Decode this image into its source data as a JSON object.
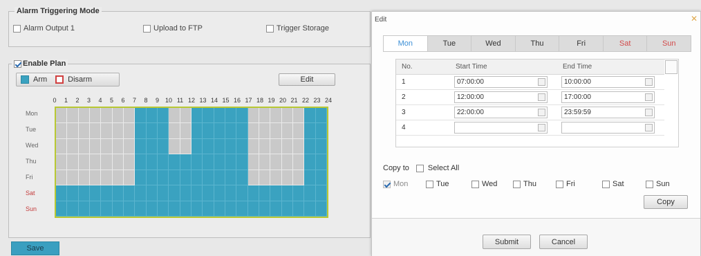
{
  "alarm_mode": {
    "title": "Alarm Triggering Mode",
    "options": [
      {
        "label": "Alarm Output 1",
        "checked": false
      },
      {
        "label": "Upload to FTP",
        "checked": false
      },
      {
        "label": "Trigger Storage",
        "checked": false
      }
    ]
  },
  "plan": {
    "title": "Enable Plan",
    "enabled": true,
    "legend_arm": "Arm",
    "legend_disarm": "Disarm",
    "edit_label": "Edit",
    "hours": [
      "0",
      "1",
      "2",
      "3",
      "4",
      "5",
      "6",
      "7",
      "8",
      "9",
      "10",
      "11",
      "12",
      "13",
      "14",
      "15",
      "16",
      "17",
      "18",
      "19",
      "20",
      "21",
      "22",
      "23",
      "24"
    ],
    "days": [
      "Mon",
      "Tue",
      "Wed",
      "Thu",
      "Fri",
      "Sat",
      "Sun"
    ],
    "schedule": [
      [
        0,
        0,
        0,
        0,
        0,
        0,
        0,
        1,
        1,
        1,
        0,
        0,
        1,
        1,
        1,
        1,
        1,
        0,
        0,
        0,
        0,
        0,
        1,
        1
      ],
      [
        0,
        0,
        0,
        0,
        0,
        0,
        0,
        1,
        1,
        1,
        0,
        0,
        1,
        1,
        1,
        1,
        1,
        0,
        0,
        0,
        0,
        0,
        1,
        1
      ],
      [
        0,
        0,
        0,
        0,
        0,
        0,
        0,
        1,
        1,
        1,
        0,
        0,
        1,
        1,
        1,
        1,
        1,
        0,
        0,
        0,
        0,
        0,
        1,
        1
      ],
      [
        0,
        0,
        0,
        0,
        0,
        0,
        0,
        1,
        1,
        1,
        1,
        1,
        1,
        1,
        1,
        1,
        1,
        0,
        0,
        0,
        0,
        0,
        1,
        1
      ],
      [
        0,
        0,
        0,
        0,
        0,
        0,
        0,
        1,
        1,
        1,
        1,
        1,
        1,
        1,
        1,
        1,
        1,
        0,
        0,
        0,
        0,
        0,
        1,
        1
      ],
      [
        1,
        1,
        1,
        1,
        1,
        1,
        1,
        1,
        1,
        1,
        1,
        1,
        1,
        1,
        1,
        1,
        1,
        1,
        1,
        1,
        1,
        1,
        1,
        1
      ],
      [
        1,
        1,
        1,
        1,
        1,
        1,
        1,
        1,
        1,
        1,
        1,
        1,
        1,
        1,
        1,
        1,
        1,
        1,
        1,
        1,
        1,
        1,
        1,
        1
      ]
    ],
    "colors": {
      "arm": "#3aa2c0",
      "disarm": "#c9c9c9",
      "border": "#b8c832"
    }
  },
  "save_label": "Save",
  "dialog": {
    "title": "Edit",
    "close_icon": "close-icon",
    "tabs": [
      "Mon",
      "Tue",
      "Wed",
      "Thu",
      "Fri",
      "Sat",
      "Sun"
    ],
    "active_tab": "Mon",
    "table": {
      "headers": [
        "No.",
        "Start Time",
        "End Time"
      ],
      "rows": [
        {
          "no": "1",
          "start": "07:00:00",
          "end": "10:00:00"
        },
        {
          "no": "2",
          "start": "12:00:00",
          "end": "17:00:00"
        },
        {
          "no": "3",
          "start": "22:00:00",
          "end": "23:59:59"
        },
        {
          "no": "4",
          "start": "",
          "end": ""
        }
      ]
    },
    "copy_to_label": "Copy to",
    "select_all_label": "Select All",
    "copy_days": [
      {
        "label": "Mon",
        "checked": true,
        "disabled": true
      },
      {
        "label": "Tue",
        "checked": false,
        "disabled": false
      },
      {
        "label": "Wed",
        "checked": false,
        "disabled": false
      },
      {
        "label": "Thu",
        "checked": false,
        "disabled": false
      },
      {
        "label": "Fri",
        "checked": false,
        "disabled": false
      },
      {
        "label": "Sat",
        "checked": false,
        "disabled": false
      },
      {
        "label": "Sun",
        "checked": false,
        "disabled": false
      }
    ],
    "copy_label": "Copy",
    "submit_label": "Submit",
    "cancel_label": "Cancel"
  }
}
